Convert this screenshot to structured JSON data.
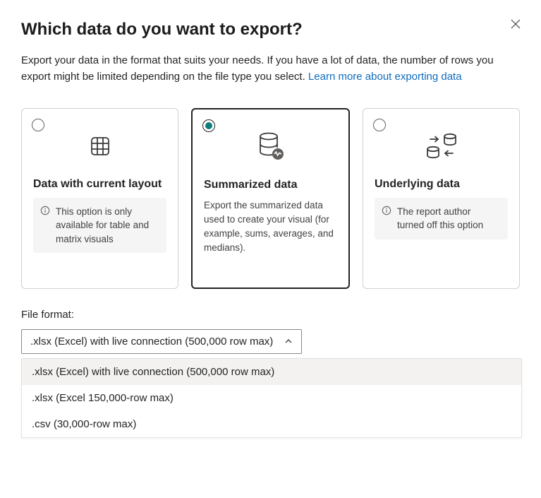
{
  "dialog": {
    "title": "Which data do you want to export?",
    "description_prefix": "Export your data in the format that suits your needs. If you have a lot of data, the number of rows you export might be limited depending on the file type you select.  ",
    "link_text": "Learn more about exporting data"
  },
  "options": [
    {
      "title": "Data with current layout",
      "note": "This option is only available for table and matrix visuals",
      "selected": false
    },
    {
      "title": "Summarized data",
      "desc": "Export the summarized data used to create your visual (for example, sums, averages, and medians).",
      "selected": true
    },
    {
      "title": "Underlying data",
      "note": "The report author turned off this option",
      "selected": false
    }
  ],
  "file_format": {
    "label": "File format:",
    "selected": ".xlsx (Excel) with live connection (500,000 row max)",
    "items": [
      ".xlsx (Excel) with live connection (500,000 row max)",
      ".xlsx (Excel 150,000-row max)",
      ".csv (30,000-row max)"
    ]
  }
}
